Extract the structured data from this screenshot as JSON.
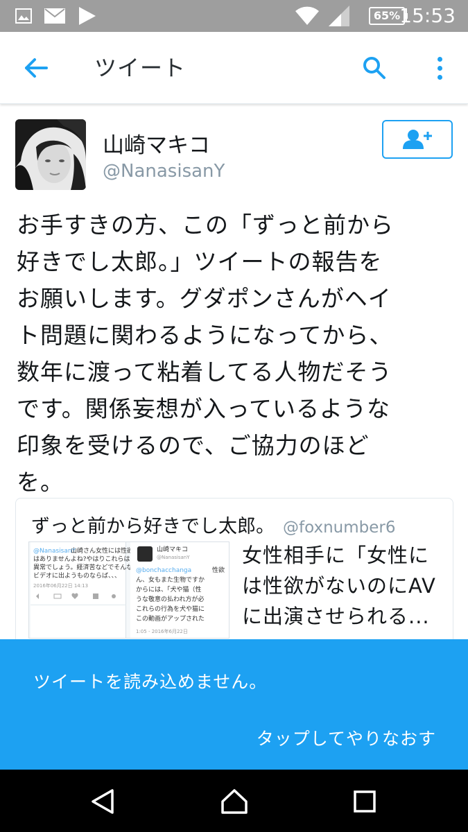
{
  "status_bar": {
    "time": "15:53",
    "battery": "65%",
    "icons": [
      "image-icon",
      "mail-icon",
      "play-icon",
      "wifi-icon",
      "signal-icon",
      "battery-icon"
    ]
  },
  "app_bar": {
    "title": "ツイート",
    "accent_color": "#1da1f2"
  },
  "tweet": {
    "display_name": "山崎マキコ",
    "screen_name": "@NanasisanY",
    "lines": [
      "お手すきの方、この「ずっと前から",
      "好きでし太郎。」ツイートの報告を",
      "お願いします。グダポンさんがヘイ",
      "ト問題に関わるようになってから、",
      "数年に渡って粘着してる人物だそう",
      "です。関係妄想が入っているような",
      "印象を受けるので、ご協力のほど",
      "を。"
    ]
  },
  "quote": {
    "name": "ずっと前から好きでし太郎。",
    "handle": "@foxnumber6",
    "text_lines": [
      "女性相手に「女性に",
      "は性欲がないのにAV",
      "に出演させられる..."
    ],
    "media_left": {
      "mention": "@NanasisanY",
      "line1": "山崎さん女性には性欲",
      "line2": "はありませんよね?やはりこれらは",
      "line3": "異常でしょう。経済苦などでそんな",
      "line4": "ビデオに出ようものならば、、、",
      "date": "2016年06月22日 14:13"
    },
    "media_right": {
      "name": "山崎マキコ",
      "handle": "@NanasisanY",
      "mention": "@bonchacchanga",
      "line1": "ん、女もまた生物ですか",
      "line2": "からには、「犬や猫（性",
      "line3": "うな敬意の払われ方が必",
      "line4": "これらの行為を犬や猫に",
      "line5": "この動画がアップされた",
      "tail": "性欲",
      "date": "1:05 - 2016年6月22日"
    }
  },
  "snackbar": {
    "message": "ツイートを読み込めません。",
    "action": "タップしてやりなおす",
    "background": "#1da1f2"
  },
  "nav_bar": {
    "buttons": [
      "back-triangle-icon",
      "home-icon",
      "recents-icon"
    ]
  }
}
